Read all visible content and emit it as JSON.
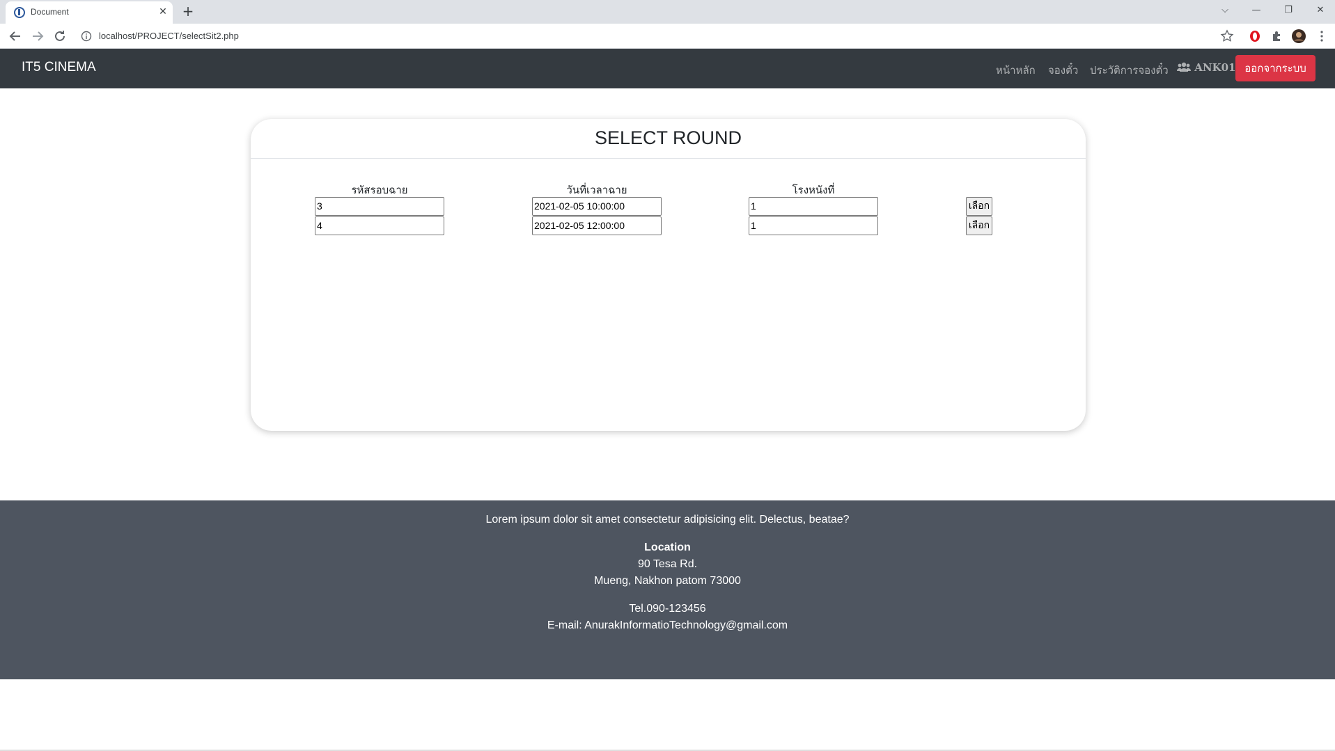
{
  "browser": {
    "tab_title": "Document",
    "url": "localhost/PROJECT/selectSit2.php"
  },
  "navbar": {
    "brand": "IT5 CINEMA",
    "links": [
      "หน้าหลัก",
      "จองตั๋ว",
      "ประวัติการจองตั๋ว"
    ],
    "user": "ANK01",
    "logout_label": "ออกจากระบบ",
    "logout_color": "#dc3545"
  },
  "card": {
    "title": "SELECT ROUND",
    "columns": [
      "รหัสรอบฉาย",
      "วันที่เวลาฉาย",
      "โรงหนังที่"
    ],
    "rows": [
      {
        "round_id": "3",
        "datetime": "2021-02-05 10:00:00",
        "theater": "1",
        "button": "เลือก"
      },
      {
        "round_id": "4",
        "datetime": "2021-02-05 12:00:00",
        "theater": "1",
        "button": "เลือก"
      }
    ]
  },
  "footer": {
    "tagline": "Lorem ipsum dolor sit amet consectetur adipisicing elit. Delectus, beatae?",
    "location_heading": "Location",
    "address_line1": "90 Tesa Rd.",
    "address_line2": "Mueng, Nakhon patom 73000",
    "tel": "Tel.090-123456",
    "email": "E-mail: AnurakInformatioTechnology@gmail.com"
  }
}
